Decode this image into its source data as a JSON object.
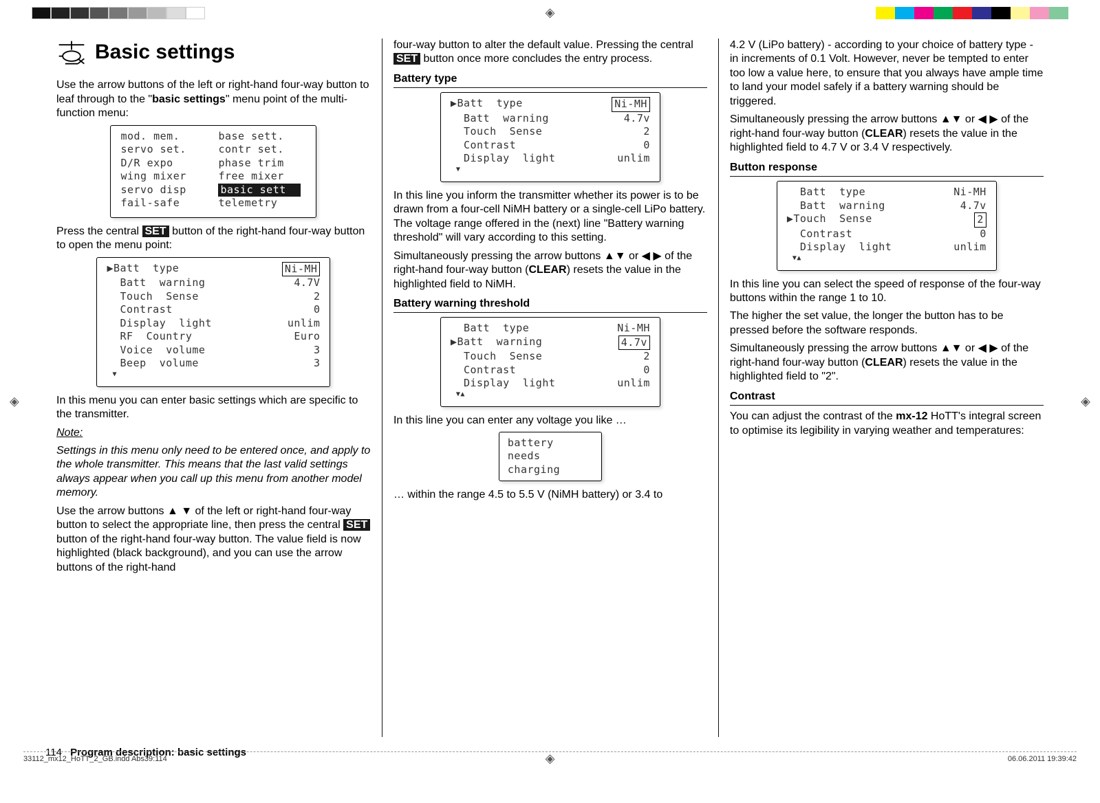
{
  "page_title": "Basic settings",
  "col1": {
    "p1a": "Use the arrow buttons of the left or right-hand four-way button to leaf through to the \"",
    "p1b": "basic settings",
    "p1c": "\" menu point of the multi-function menu:",
    "menu": {
      "r1a": "mod. mem.",
      "r1b": "base sett.",
      "r2a": "servo set.",
      "r2b": "contr set.",
      "r3a": "D/R expo",
      "r3b": "phase trim",
      "r4a": "wing mixer",
      "r4b": "free mixer",
      "r5a": "servo disp",
      "r5b": "basic sett",
      "r6a": "fail-safe",
      "r6b": "telemetry"
    },
    "p2a": "Press the central ",
    "p2b": "SET",
    "p2c": " button of the right-hand four-way button to open the menu point:",
    "lcd1": {
      "r1l": "Batt  type",
      "r1r": "Ni-MH",
      "r2l": "Batt  warning",
      "r2r": "4.7V",
      "r3l": "Touch  Sense",
      "r3r": "2",
      "r4l": "Contrast",
      "r4r": "0",
      "r5l": "Display  light",
      "r5r": "unlim",
      "r6l": "RF  Country",
      "r6r": "Euro",
      "r7l": "Voice  volume",
      "r7r": "3",
      "r8l": "Beep  volume",
      "r8r": "3"
    },
    "p3": "In this menu you can enter basic settings which are specific to the transmitter.",
    "note_label": "Note:",
    "note": "Settings in this menu only need to be entered once, and apply to the whole transmitter. This means that the last valid settings always appear when you call up this menu from another model memory.",
    "p4a": "Use the arrow buttons ▲ ▼ of the left or right-hand four-way button to select the appropriate line, then press the central ",
    "p4b": "SET",
    "p4c": " button of the right-hand four-way button. The value field is now highlighted (black background), and you can use the arrow buttons of the right-hand"
  },
  "col2": {
    "p1a": "four-way button to alter the default value. Pressing the central ",
    "p1b": "SET",
    "p1c": " button once more concludes the entry process.",
    "h1": "Battery type",
    "lcd2": {
      "r1l": "Batt  type",
      "r1r": "Ni-MH",
      "r2l": "Batt  warning",
      "r2r": "4.7v",
      "r3l": "Touch  Sense",
      "r3r": "2",
      "r4l": "Contrast",
      "r4r": "0",
      "r5l": "Display  light",
      "r5r": "unlim"
    },
    "p2": "In this line you inform the transmitter whether its power is to be drawn from a four-cell NiMH battery or a single-cell LiPo battery. The voltage range offered in the (next) line \"Battery warning threshold\" will vary according to this setting.",
    "p3a": "Simultaneously pressing the arrow buttons ▲▼ or ◀ ▶ of the right-hand four-way button (",
    "p3b": "CLEAR",
    "p3c": ") resets the value in the highlighted field to NiMH.",
    "h2": "Battery warning threshold",
    "lcd3": {
      "r1l": "Batt  type",
      "r1r": "Ni-MH",
      "r2l": "Batt  warning",
      "r2r": "4.7v",
      "r3l": "Touch  Sense",
      "r3r": "2",
      "r4l": "Contrast",
      "r4r": "0",
      "r5l": "Display  light",
      "r5r": "unlim"
    },
    "p4": "In this line you can enter any voltage you like …",
    "tiny": {
      "l1": "battery",
      "l2": "needs",
      "l3": "charging"
    },
    "p5": "… within the range 4.5 to 5.5 V (NiMH battery) or 3.4 to"
  },
  "col3": {
    "p1": "4.2 V (LiPo battery) - according to your choice of battery type - in increments of 0.1 Volt. However, never be tempted to enter too low a value here, to ensure that you always have ample time to land your model safely if a battery warning should be triggered.",
    "p2a": "Simultaneously pressing the arrow buttons ▲▼ or ◀ ▶ of the right-hand four-way button (",
    "p2b": "CLEAR",
    "p2c": ") resets the value in the highlighted field to 4.7 V or 3.4 V respectively.",
    "h1": "Button response",
    "lcd4": {
      "r1l": "Batt  type",
      "r1r": "Ni-MH",
      "r2l": "Batt  warning",
      "r2r": "4.7v",
      "r3l": "Touch  Sense",
      "r3r": "2",
      "r4l": "Contrast",
      "r4r": "0",
      "r5l": "Display  light",
      "r5r": "unlim"
    },
    "p3": "In this line you can select the speed of response of the four-way buttons within the range 1 to 10.",
    "p4": "The higher the set value, the longer the button has to be pressed before the software responds.",
    "p5a": "Simultaneously pressing the arrow buttons ▲▼ or ◀ ▶ of the right-hand four-way button (",
    "p5b": "CLEAR",
    "p5c": ") resets the value in the highlighted field to \"2\".",
    "h2": "Contrast",
    "p6a": "You can adjust the contrast of the ",
    "p6b": "mx-12",
    "p6c": " HoTT's integral screen to optimise its legibility in varying weather and temperatures:"
  },
  "footer": {
    "page_num": "114",
    "page_title": "Program description: basic settings",
    "file": "33112_mx12_HoTT_2_GB.indd   Abs39:114",
    "date": "06.06.2011   19:39:42"
  }
}
